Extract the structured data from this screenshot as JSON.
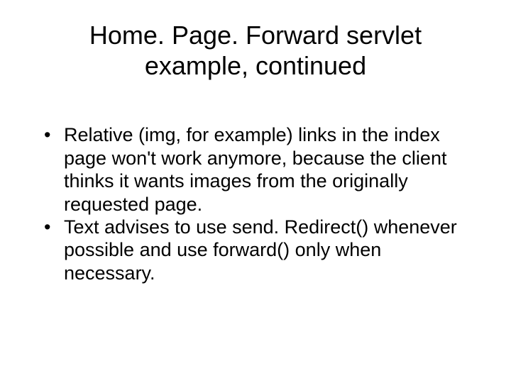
{
  "title": "Home. Page. Forward servlet example, continued",
  "bullets": [
    "Relative (img, for example) links in the index page won't work anymore, because the client thinks it wants images from the originally requested page.",
    "Text advises to use send. Redirect() whenever possible and use forward() only when necessary."
  ]
}
